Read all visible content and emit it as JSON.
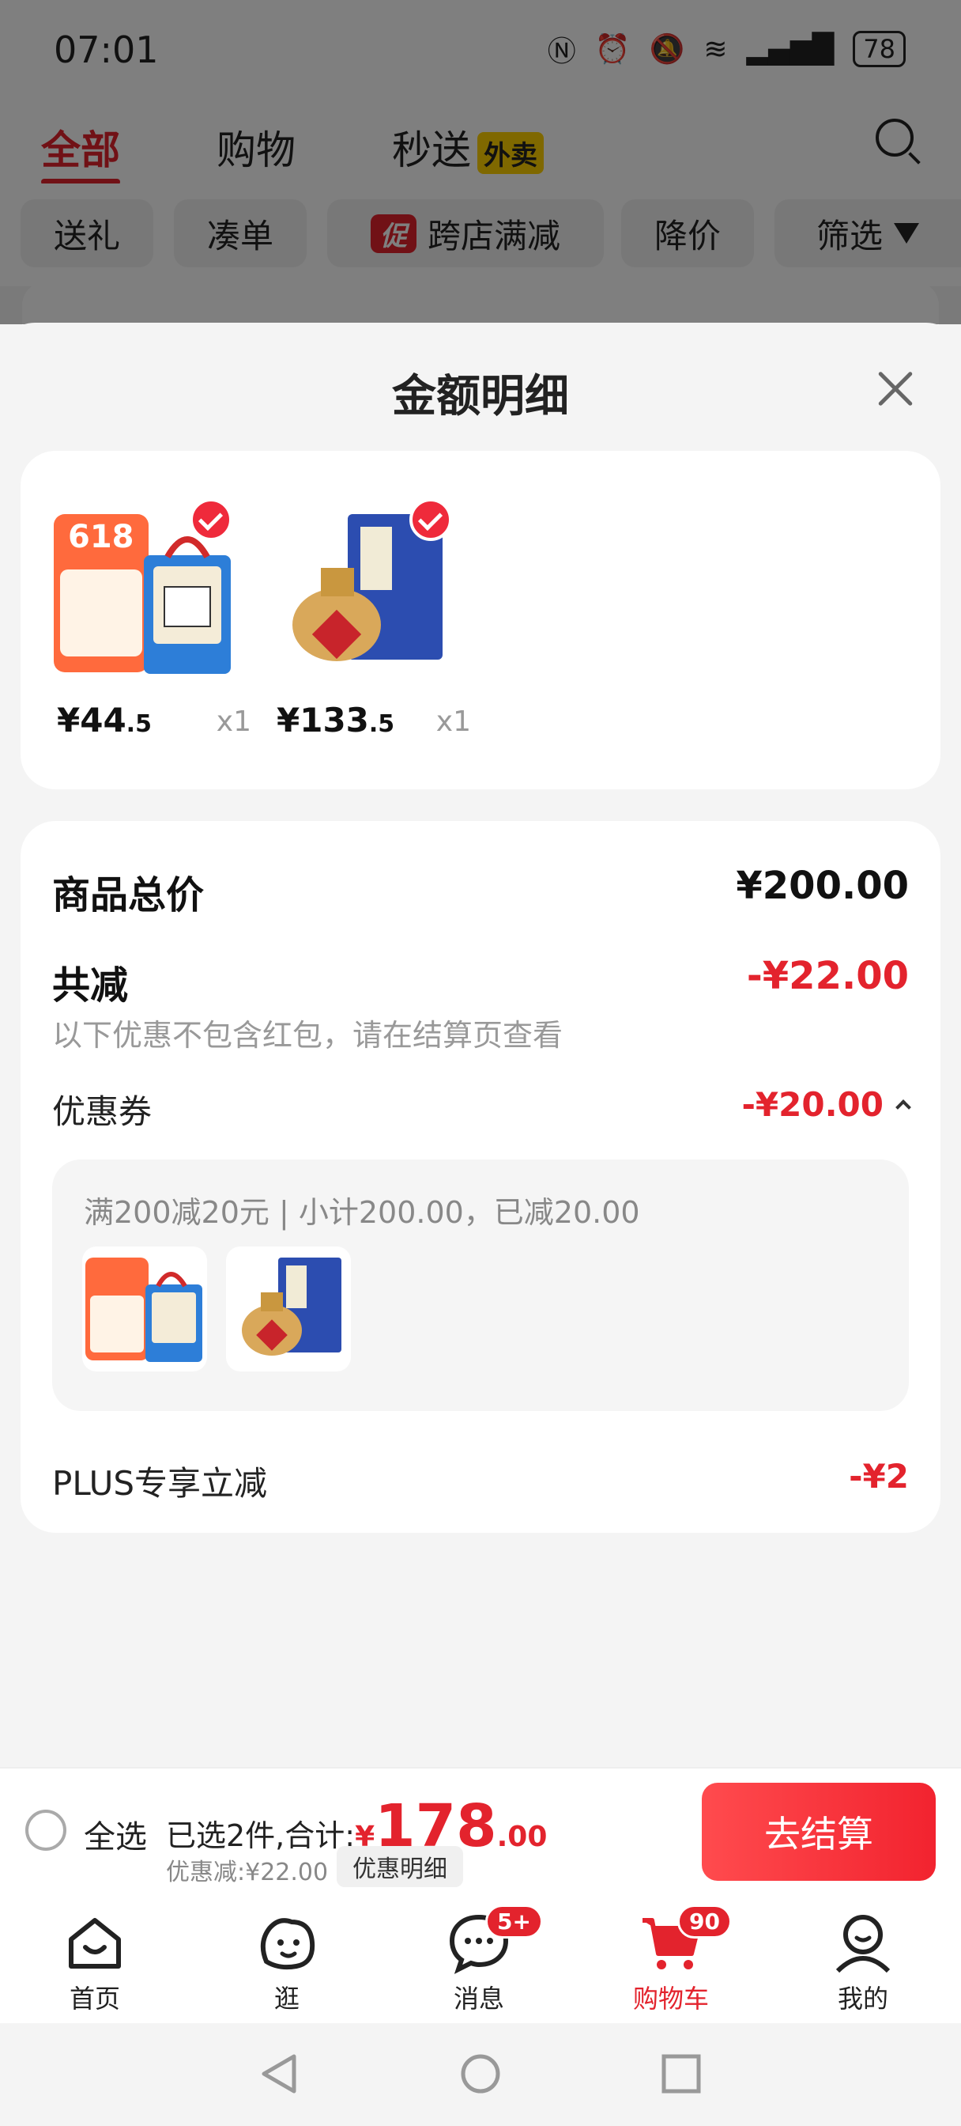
{
  "status_bar": {
    "time": "07:01",
    "battery": "78"
  },
  "top_tabs": {
    "all": "全部",
    "shopping": "购物",
    "flash": "秒送",
    "takeout": "外卖"
  },
  "filter_chips": {
    "gift": "送礼",
    "combo": "凑单",
    "promo_tag": "促",
    "cross_store": "跨店满减",
    "price_drop": "降价",
    "filter": "筛选"
  },
  "sheet": {
    "title": "金额明细"
  },
  "products": [
    {
      "price_int": "¥44",
      "price_dec": ".5",
      "qty": "x1"
    },
    {
      "price_int": "¥133",
      "price_dec": ".5",
      "qty": "x1"
    }
  ],
  "summary": {
    "goods_total_label": "商品总价",
    "goods_total_value": "¥200.00",
    "reduce_label": "共减",
    "reduce_value": "-¥22.00",
    "reduce_note": "以下优惠不包含红包，请在结算页查看",
    "coupon_label": "优惠券",
    "coupon_value": "-¥20.00",
    "coupon_detail": "满200减20元 | 小计200.00，已减20.00",
    "plus_label": "PLUS专享立减",
    "plus_value": "-¥2"
  },
  "checkout": {
    "select_all": "全选",
    "selected_summary": "已选2件,合计:",
    "total_currency": "¥",
    "total_int": "178",
    "total_dec": ".00",
    "discount_note": "优惠减:¥22.00",
    "detail_button": "优惠明细",
    "checkout_button": "去结算"
  },
  "bottom_nav": {
    "home": "首页",
    "browse": "逛",
    "messages": "消息",
    "messages_badge": "5+",
    "cart": "购物车",
    "cart_badge": "90",
    "mine": "我的"
  },
  "colors": {
    "accent": "#e3232d",
    "background": "#f4f4f4"
  }
}
